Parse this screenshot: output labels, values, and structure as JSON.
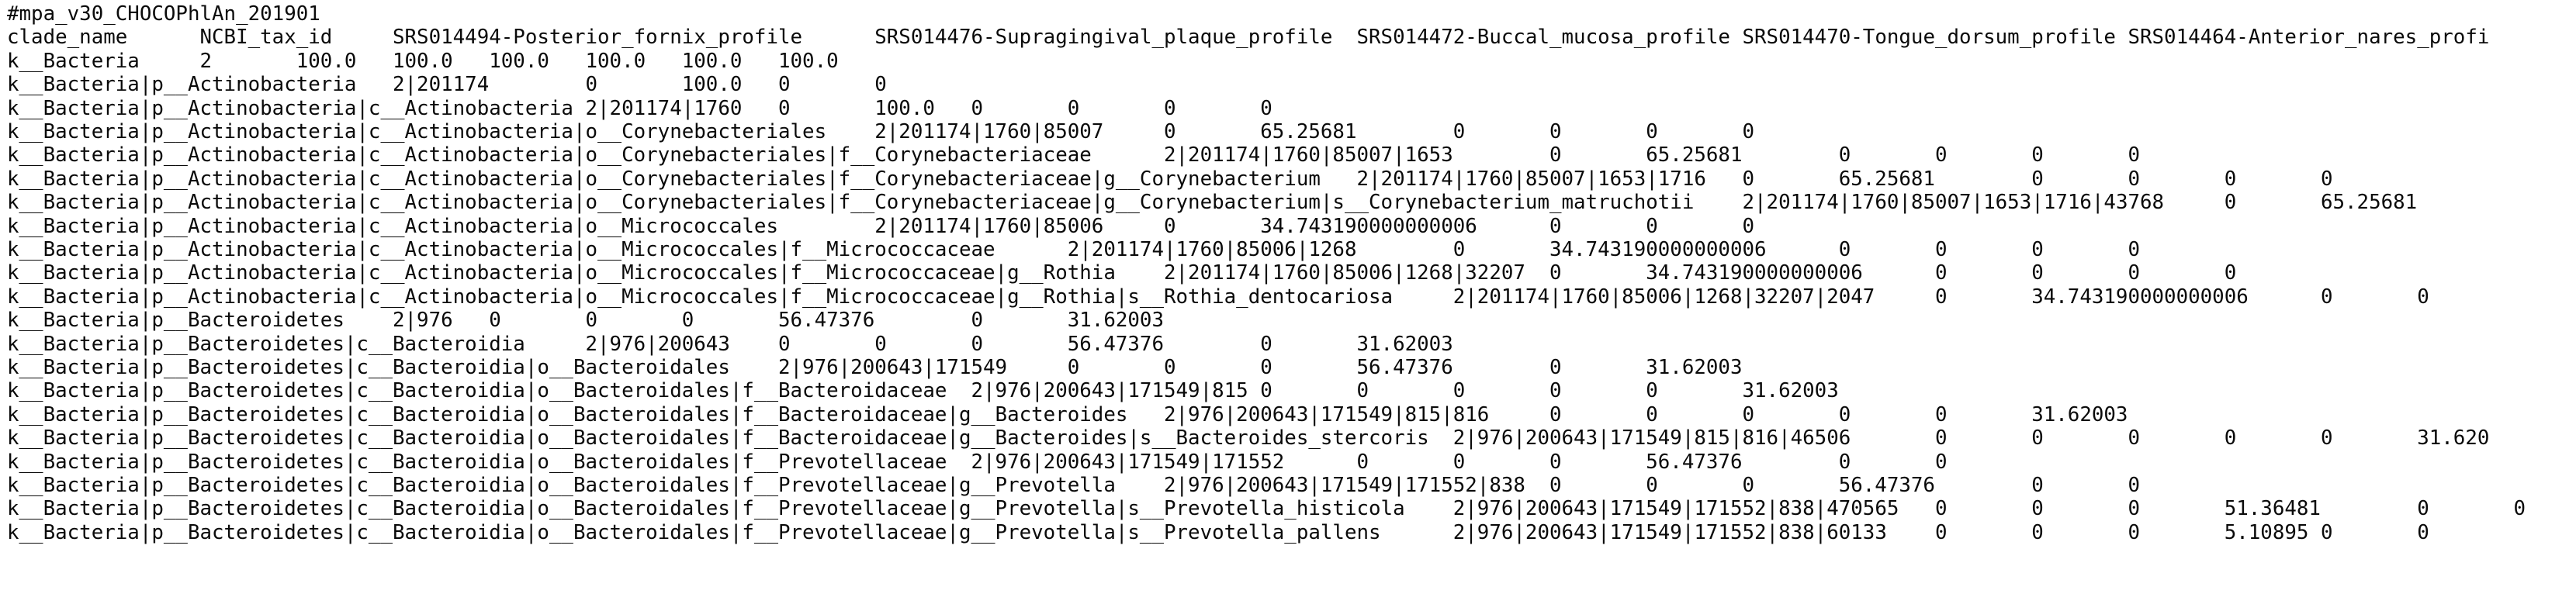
{
  "document": {
    "lines": [
      "#mpa_v30_CHOCOPhlAn_201901",
      "clade_name\tNCBI_tax_id\tSRS014494-Posterior_fornix_profile\tSRS014476-Supragingival_plaque_profile\tSRS014472-Buccal_mucosa_profile\tSRS014470-Tongue_dorsum_profile\tSRS014464-Anterior_nares_profi",
      "k__Bacteria\t2\t100.0\t100.0\t100.0\t100.0\t100.0\t100.0",
      "k__Bacteria|p__Actinobacteria\t2|201174\t0\t100.0\t0\t0",
      "k__Bacteria|p__Actinobacteria|c__Actinobacteria\t2|201174|1760\t0\t100.0\t0\t0\t0\t0",
      "k__Bacteria|p__Actinobacteria|c__Actinobacteria|o__Corynebacteriales\t2|201174|1760|85007\t0\t65.25681\t0\t0\t0\t0",
      "k__Bacteria|p__Actinobacteria|c__Actinobacteria|o__Corynebacteriales|f__Corynebacteriaceae\t2|201174|1760|85007|1653\t0\t65.25681\t0\t0\t0\t0",
      "k__Bacteria|p__Actinobacteria|c__Actinobacteria|o__Corynebacteriales|f__Corynebacteriaceae|g__Corynebacterium\t2|201174|1760|85007|1653|1716\t0\t65.25681\t0\t0\t0\t0",
      "k__Bacteria|p__Actinobacteria|c__Actinobacteria|o__Corynebacteriales|f__Corynebacteriaceae|g__Corynebacterium|s__Corynebacterium_matruchotii\t2|201174|1760|85007|1653|1716|43768\t0\t65.25681",
      "k__Bacteria|p__Actinobacteria|c__Actinobacteria|o__Micrococcales\t2|201174|1760|85006\t0\t34.743190000000006\t0\t0\t0",
      "k__Bacteria|p__Actinobacteria|c__Actinobacteria|o__Micrococcales|f__Micrococcaceae\t2|201174|1760|85006|1268\t0\t34.743190000000006\t0\t0\t0\t0",
      "k__Bacteria|p__Actinobacteria|c__Actinobacteria|o__Micrococcales|f__Micrococcaceae|g__Rothia\t2|201174|1760|85006|1268|32207\t0\t34.743190000000006\t0\t0\t0\t0",
      "k__Bacteria|p__Actinobacteria|c__Actinobacteria|o__Micrococcales|f__Micrococcaceae|g__Rothia|s__Rothia_dentocariosa\t2|201174|1760|85006|1268|32207|2047\t0\t34.743190000000006\t0\t0",
      "k__Bacteria|p__Bacteroidetes\t2|976\t0\t0\t0\t56.47376\t0\t31.62003",
      "k__Bacteria|p__Bacteroidetes|c__Bacteroidia\t2|976|200643\t0\t0\t0\t56.47376\t0\t31.62003",
      "k__Bacteria|p__Bacteroidetes|c__Bacteroidia|o__Bacteroidales\t2|976|200643|171549\t0\t0\t0\t56.47376\t0\t31.62003",
      "k__Bacteria|p__Bacteroidetes|c__Bacteroidia|o__Bacteroidales|f__Bacteroidaceae\t2|976|200643|171549|815\t0\t0\t0\t0\t0\t31.62003",
      "k__Bacteria|p__Bacteroidetes|c__Bacteroidia|o__Bacteroidales|f__Bacteroidaceae|g__Bacteroides\t2|976|200643|171549|815|816\t0\t0\t0\t0\t0\t31.62003",
      "k__Bacteria|p__Bacteroidetes|c__Bacteroidia|o__Bacteroidales|f__Bacteroidaceae|g__Bacteroides|s__Bacteroides_stercoris\t2|976|200643|171549|815|816|46506\t0\t0\t0\t0\t0\t31.620",
      "k__Bacteria|p__Bacteroidetes|c__Bacteroidia|o__Bacteroidales|f__Prevotellaceae\t2|976|200643|171549|171552\t0\t0\t0\t56.47376\t0\t0",
      "k__Bacteria|p__Bacteroidetes|c__Bacteroidia|o__Bacteroidales|f__Prevotellaceae|g__Prevotella\t2|976|200643|171549|171552|838\t0\t0\t0\t56.47376\t0\t0",
      "k__Bacteria|p__Bacteroidetes|c__Bacteroidia|o__Bacteroidales|f__Prevotellaceae|g__Prevotella|s__Prevotella_histicola\t2|976|200643|171549|171552|838|470565\t0\t0\t0\t51.36481\t0\t0",
      "k__Bacteria|p__Bacteroidetes|c__Bacteroidia|o__Bacteroidales|f__Prevotellaceae|g__Prevotella|s__Prevotella_pallens\t2|976|200643|171549|171552|838|60133\t0\t0\t0\t5.10895 0\t0"
    ]
  }
}
